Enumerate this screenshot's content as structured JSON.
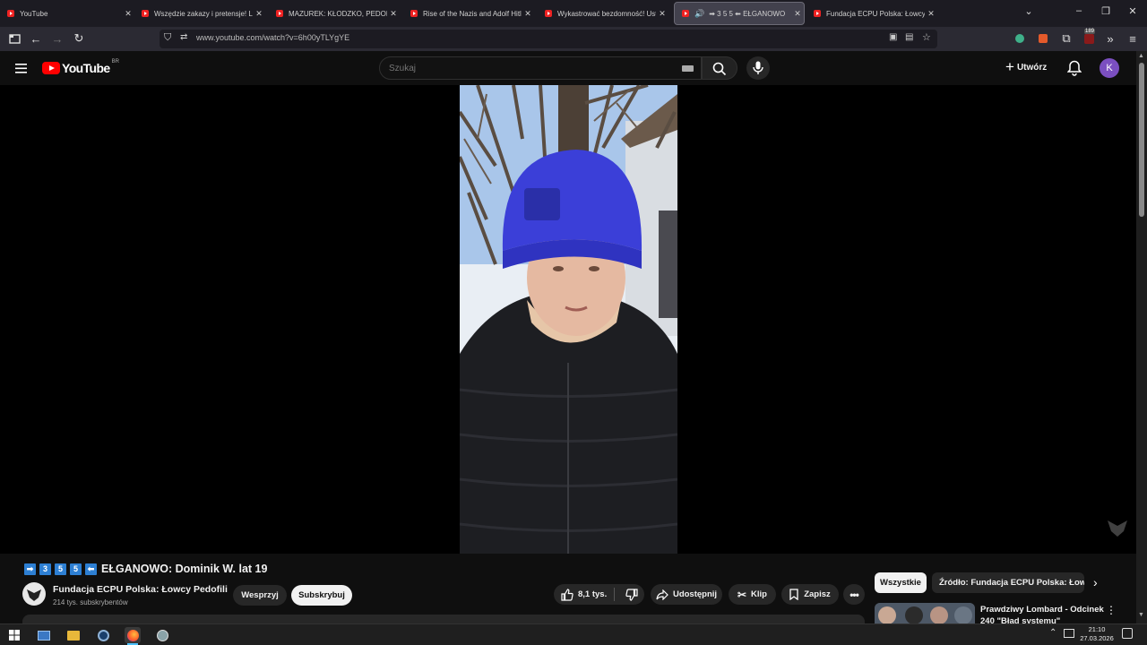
{
  "tabs": [
    {
      "title": "YouTube",
      "active": false,
      "speaker": false
    },
    {
      "title": "Wszędzie zakazy i pretensje! Lu",
      "active": false,
      "speaker": false
    },
    {
      "title": "MAZUREK: KŁODZKO, PEDOFILI",
      "active": false,
      "speaker": false
    },
    {
      "title": "Rise of the Nazis and Adolf Hitl",
      "active": false,
      "speaker": false
    },
    {
      "title": "Wykastrować bezdomność! Ust",
      "active": false,
      "speaker": false
    },
    {
      "title": "➡ 3 5 5 ⬅ EŁGANOWO",
      "active": true,
      "speaker": true
    },
    {
      "title": "Fundacja ECPU Polska: Łowcy P",
      "active": false,
      "speaker": false
    }
  ],
  "browser": {
    "url": "www.youtube.com/watch?v=6h00yTLYgYE",
    "extension_badge": "189"
  },
  "youtube": {
    "logo_text": "YouTube",
    "region": "BR",
    "search_placeholder": "Szukaj",
    "create_label": "Utwórz",
    "avatar_letter": "K"
  },
  "video": {
    "badges": [
      "➡",
      "3",
      "5",
      "5",
      "⬅"
    ],
    "title": "EŁGANOWO: Dominik W. lat 19",
    "channel_name": "Fundacja ECPU Polska: Łowcy Pedofili",
    "subscribers": "214 tys. subskrybentów",
    "support_label": "Wesprzyj",
    "subscribe_label": "Subskrybuj",
    "likes": "8,1 tys.",
    "share_label": "Udostępnij",
    "clip_label": "Klip",
    "save_label": "Zapisz"
  },
  "sidebar": {
    "chips": [
      "Wszystkie",
      "Źródło: Fundacja ECPU Polska: Łowcy"
    ],
    "rec_title_line1": "Prawdziwy Lombard - Odcinek",
    "rec_title_line2": "240 \"Błąd systemu\""
  },
  "taskbar": {
    "time": "21:10",
    "date": "27.03.2026"
  },
  "colors": {
    "yt_red": "#ff0000",
    "avatar_purple": "#7b4fc0",
    "badge_blue": "#2d7fd3",
    "hat_blue": "#3b3fd8"
  }
}
